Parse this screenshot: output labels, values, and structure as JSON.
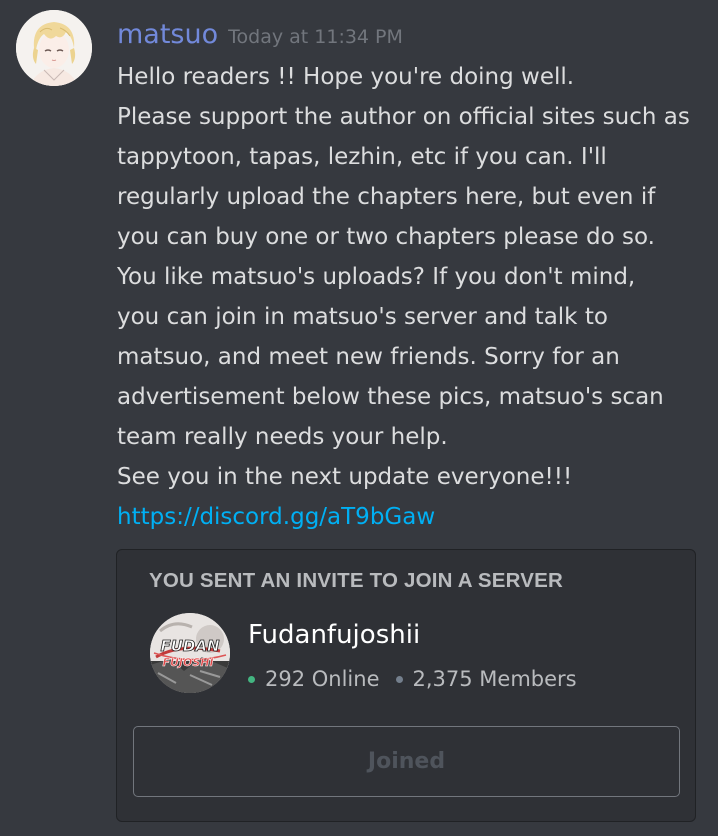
{
  "message": {
    "username": "matsuo",
    "timestamp": "Today at 11:34 PM",
    "avatar_icon": "user-avatar-blonde",
    "lines": [
      "Hello readers !! Hope you're doing well.",
      "Please support the author on official sites such as",
      "tappytoon, tapas, lezhin, etc if you can. I'll",
      "regularly upload the chapters here, but even if",
      "you can buy one or two chapters please do so.",
      "You like matsuo's uploads? If you don't mind,",
      "you can join in matsuo's server and talk to",
      "matsuo, and meet new friends. Sorry for an",
      "advertisement below these pics, matsuo's scan",
      "team really needs your help.",
      "See you in the next update everyone!!!"
    ],
    "link": "https://discord.gg/aT9bGaw"
  },
  "invite": {
    "title": "YOU SENT AN INVITE TO JOIN A SERVER",
    "server_name": "Fudanfujoshii",
    "server_icon": "server-icon-fudanfujoshi",
    "server_icon_text_top": "FUDAN",
    "server_icon_text_bottom": "FUJOSHI",
    "online": "292 Online",
    "members": "2,375 Members",
    "button_label": "Joined"
  },
  "colors": {
    "background": "#36393f",
    "username": "#7289da",
    "link": "#00b0f4",
    "online_dot": "#43b581",
    "embed_background": "#2f3136"
  }
}
